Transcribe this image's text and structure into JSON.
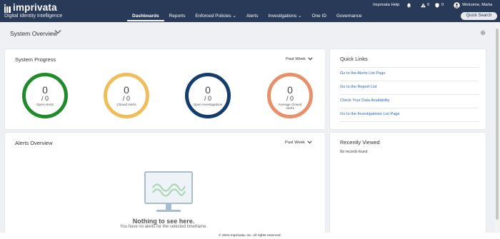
{
  "brand": {
    "name": "imprivata",
    "subtitle": "Digital Identity Intelligence"
  },
  "nav": [
    {
      "label": "Dashboards",
      "active": true
    },
    {
      "label": "Reports"
    },
    {
      "label": "Enforced Policies ⌄"
    },
    {
      "label": "Alerts"
    },
    {
      "label": "Investigations ⌄"
    },
    {
      "label": "One ID"
    },
    {
      "label": "Governance"
    }
  ],
  "utility": {
    "help": "Imprivata Help",
    "alerts_count": "0",
    "shield_count": "0",
    "welcome": "Welcome, Marta",
    "quick_search": "Quick Search"
  },
  "page": {
    "title": "System Overview"
  },
  "system_progress": {
    "title": "System Progress",
    "period": "Past Week",
    "metrics": [
      {
        "count": "0",
        "denominator": "/ 0",
        "label": "Open Alerts",
        "color": "#1f8b2a"
      },
      {
        "count": "0",
        "denominator": "/ 0",
        "label": "Closed Alerts",
        "color": "#efbe5a"
      },
      {
        "count": "0",
        "denominator": "/ 0",
        "label": "Open Investigations",
        "color": "#143d6b"
      },
      {
        "count": "0",
        "denominator": "/ 0",
        "label": "Average Closed Alerts",
        "color": "#e8906a"
      }
    ]
  },
  "quick_links": {
    "title": "Quick Links",
    "links": [
      "Go to the Alerts List Page",
      "Go to the Report List",
      "Check Your Data Availability",
      "Go to the Investigations List Page"
    ]
  },
  "alerts_overview": {
    "title": "Alerts Overview",
    "period": "Past Week",
    "empty_title": "Nothing to see here.",
    "empty_subtitle": "You have no alerts for the selected timeframe."
  },
  "recently_viewed": {
    "title": "Recently Viewed",
    "empty": "No records found"
  },
  "footer": "© 2024 Imprivata, Inc. All rights reserved."
}
